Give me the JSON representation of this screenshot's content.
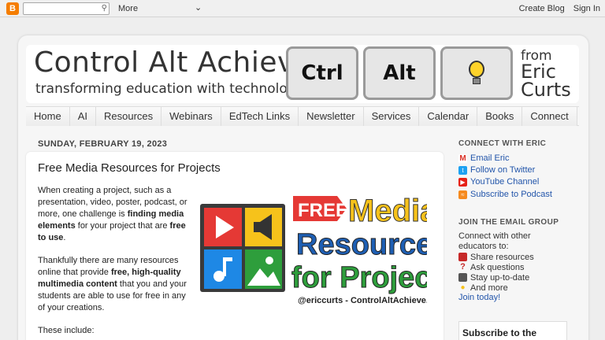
{
  "navbar": {
    "more": "More",
    "create_blog": "Create Blog",
    "sign_in": "Sign In"
  },
  "header": {
    "title": "Control Alt Achieve",
    "subtitle": "transforming education with technology",
    "key1": "Ctrl",
    "key2": "Alt",
    "from": "from",
    "author_first": "Eric",
    "author_last": "Curts"
  },
  "tabs": [
    "Home",
    "AI",
    "Resources",
    "Webinars",
    "EdTech Links",
    "Newsletter",
    "Services",
    "Calendar",
    "Books",
    "Connect"
  ],
  "post": {
    "date": "SUNDAY, FEBRUARY 19, 2023",
    "title": "Free Media Resources for Projects",
    "p1_a": "When creating a project, such as a presentation, video, poster, podcast, or more, one challenge is ",
    "p1_b": "finding media elements",
    "p1_c": " for your project that are ",
    "p1_d": "free to use",
    "p1_e": ".",
    "p2_a": "Thankfully there are many resources online that provide ",
    "p2_b": "free, high-quality multimedia content",
    "p2_c": " that you and your students are able to use for free in any of your creations.",
    "p3": "These include:",
    "image": {
      "free": "FREE",
      "media": "Media",
      "resources": "Resources",
      "for_projects": "for Projects",
      "credit": "@ericcurts - ControlAltAchieve.com"
    }
  },
  "sidebar": {
    "connect_heading": "CONNECT WITH ERIC",
    "links": [
      {
        "label": "Email Eric",
        "icon": "gmail-icon",
        "color": "#d93025"
      },
      {
        "label": "Follow on Twitter",
        "icon": "twitter-icon",
        "color": "#1da1f2"
      },
      {
        "label": "YouTube Channel",
        "icon": "youtube-icon",
        "color": "#e62117"
      },
      {
        "label": "Subscribe to Podcast",
        "icon": "rss-icon",
        "color": "#f68a1f"
      }
    ],
    "email_heading": "JOIN THE EMAIL GROUP",
    "email_intro": "Connect with other educators to:",
    "bullets": [
      "Share resources",
      "Ask questions",
      "Stay up-to-date",
      "And more"
    ],
    "join": "Join today!",
    "subscribe_box": "Subscribe to the"
  },
  "colors": {
    "accent": "#2255aa",
    "free_red": "#e53935",
    "media_yellow": "#f6c21b",
    "resources_blue": "#1e5fb4",
    "projects_green": "#2e9e3c"
  }
}
